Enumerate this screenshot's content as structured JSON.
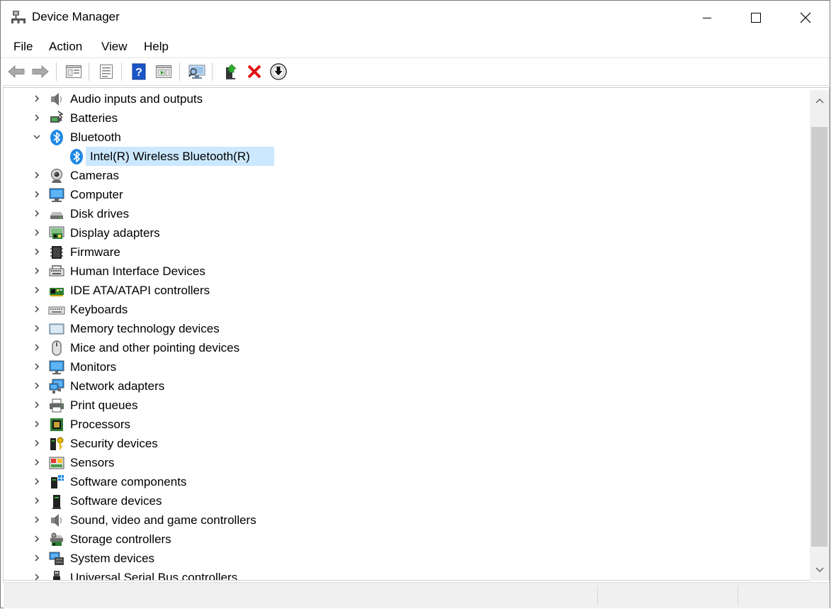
{
  "window": {
    "title": "Device Manager",
    "minimize_icon": "minimize-icon",
    "maximize_icon": "maximize-icon",
    "close_icon": "close-icon"
  },
  "menu": [
    "File",
    "Action",
    "View",
    "Help"
  ],
  "toolbar": {
    "buttons": [
      "back-icon",
      "forward-icon",
      "show-hide-console-tree-icon",
      "properties-icon",
      "help-icon",
      "action-pane-icon",
      "scan-hardware-changes-icon",
      "update-driver-icon",
      "uninstall-device-icon",
      "disable-device-icon"
    ]
  },
  "tree": {
    "items": [
      {
        "label": "Audio inputs and outputs",
        "icon": "speaker-icon",
        "expanded": false
      },
      {
        "label": "Batteries",
        "icon": "battery-icon",
        "expanded": false
      },
      {
        "label": "Bluetooth",
        "icon": "bluetooth-icon",
        "expanded": true
      },
      {
        "label": "Intel(R) Wireless Bluetooth(R)",
        "icon": "bluetooth-icon",
        "child": true,
        "selected": true
      },
      {
        "label": "Cameras",
        "icon": "camera-icon",
        "expanded": false
      },
      {
        "label": "Computer",
        "icon": "computer-icon",
        "expanded": false
      },
      {
        "label": "Disk drives",
        "icon": "disk-drive-icon",
        "expanded": false
      },
      {
        "label": "Display adapters",
        "icon": "display-adapter-icon",
        "expanded": false
      },
      {
        "label": "Firmware",
        "icon": "firmware-icon",
        "expanded": false
      },
      {
        "label": "Human Interface Devices",
        "icon": "hid-icon",
        "expanded": false
      },
      {
        "label": "IDE ATA/ATAPI controllers",
        "icon": "ide-controller-icon",
        "expanded": false
      },
      {
        "label": "Keyboards",
        "icon": "keyboard-icon",
        "expanded": false
      },
      {
        "label": "Memory technology devices",
        "icon": "memory-icon",
        "expanded": false
      },
      {
        "label": "Mice and other pointing devices",
        "icon": "mouse-icon",
        "expanded": false
      },
      {
        "label": "Monitors",
        "icon": "monitor-icon",
        "expanded": false
      },
      {
        "label": "Network adapters",
        "icon": "network-adapter-icon",
        "expanded": false
      },
      {
        "label": "Print queues",
        "icon": "printer-icon",
        "expanded": false
      },
      {
        "label": "Processors",
        "icon": "processor-icon",
        "expanded": false
      },
      {
        "label": "Security devices",
        "icon": "security-device-icon",
        "expanded": false
      },
      {
        "label": "Sensors",
        "icon": "sensor-icon",
        "expanded": false
      },
      {
        "label": "Software components",
        "icon": "software-component-icon",
        "expanded": false
      },
      {
        "label": "Software devices",
        "icon": "software-device-icon",
        "expanded": false
      },
      {
        "label": "Sound, video and game controllers",
        "icon": "speaker-icon",
        "expanded": false
      },
      {
        "label": "Storage controllers",
        "icon": "storage-controller-icon",
        "expanded": false
      },
      {
        "label": "System devices",
        "icon": "system-device-icon",
        "expanded": false
      },
      {
        "label": "Universal Serial Bus controllers",
        "icon": "usb-icon",
        "expanded": false
      }
    ]
  },
  "colors": {
    "selection": "#cce8ff",
    "accent_blue": "#1e88e5",
    "uninstall_red": "#e01010"
  }
}
